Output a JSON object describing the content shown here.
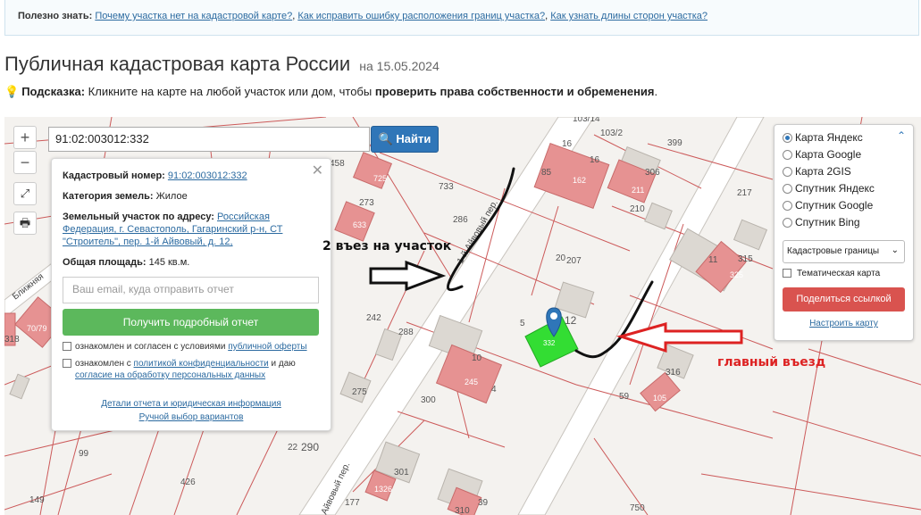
{
  "topbar": {
    "prefix": "Полезно знать:",
    "links": [
      "Почему участка нет на кадастровой карте?",
      "Как исправить ошибку расположения границ участка?",
      "Как узнать длины сторон участка?"
    ]
  },
  "title": {
    "main": "Публичная кадастровая карта России",
    "date": "на 15.05.2024"
  },
  "hint": {
    "label": "Подсказка:",
    "text": " Кликните на карте на любой участок или дом, чтобы ",
    "bold": "проверить права собственности и обременения",
    "end": "."
  },
  "search": {
    "value": "91:02:003012:332",
    "button": "Найти"
  },
  "popup": {
    "cad_label": "Кадастровый номер:",
    "cad_value": "91:02:003012:332",
    "cat_label": "Категория земель:",
    "cat_value": "Жилое",
    "addr_label": "Земельный участок по адресу:",
    "addr_value": "Российская Федерация, г. Севастополь, Гагаринский р-н, СТ \"Строитель\", пер. 1-й Айвовый, д. 12,",
    "area_label": "Общая площадь:",
    "area_value": "145 кв.м.",
    "email_placeholder": "Ваш email, куда отправить отчет",
    "report_button": "Получить подробный отчет",
    "consent1_text": "ознакомлен и согласен с условиями ",
    "consent1_link": "публичной оферты",
    "consent2_text": "ознакомлен с ",
    "consent2_link": "политикой конфиденциальности",
    "consent2_mid": " и даю ",
    "consent2_link2": "согласие на обработку персональных данных",
    "details_link": "Детали отчета и юридическая информация",
    "manual_link": "Ручной выбор вариантов"
  },
  "layers": {
    "options": [
      "Карта Яндекс",
      "Карта Google",
      "Карта 2GIS",
      "Спутник Яндекс",
      "Спутник Google",
      "Спутник Bing"
    ],
    "selected_index": 0,
    "select_value": "Кадастровые границы",
    "thematic": "Тематическая карта",
    "share": "Поделиться ссылкой",
    "setup": "Настроить карту"
  },
  "annotations": {
    "entry2": "2 въез на участок",
    "main_entry": "главный въезд"
  },
  "map_labels": {
    "parcel_numbers": [
      "733",
      "286",
      "273",
      "725",
      "633",
      "458",
      "103/14",
      "103/2",
      "16",
      "162",
      "85",
      "306",
      "211",
      "210",
      "399",
      "217",
      "315",
      "325",
      "11",
      "207",
      "20",
      "12",
      "332",
      "5",
      "242",
      "288",
      "10",
      "245",
      "4",
      "275",
      "300",
      "316",
      "105",
      "59",
      "290",
      "22",
      "301",
      "426",
      "99",
      "149",
      "177",
      "310",
      "39",
      "750",
      "318",
      "70/79",
      "1326",
      "12"
    ],
    "streets": [
      "1-й Айвовый пер.",
      "Ближняя",
      "Айвовый пер."
    ]
  },
  "colors": {
    "accent": "#2f76b8",
    "report": "#5cb85c",
    "share": "#d9534f",
    "parcel_line": "#c85050",
    "building": "#e48d8d",
    "selected": "#33dd33",
    "arrow_red": "#dd2222"
  }
}
